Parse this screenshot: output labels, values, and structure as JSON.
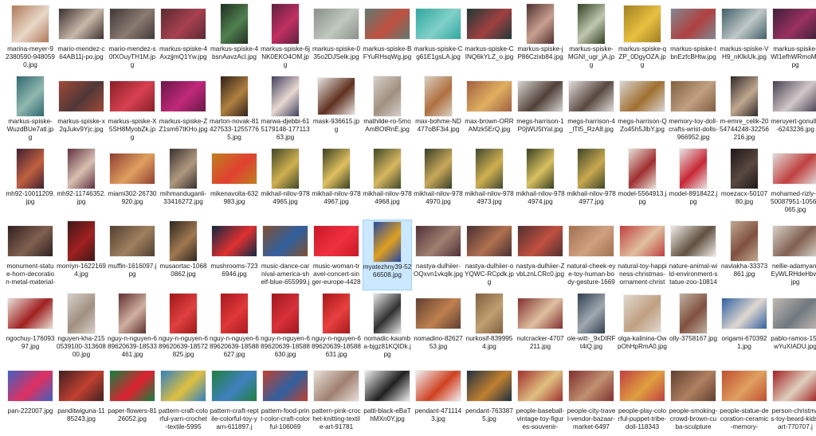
{
  "selected_index": 55,
  "files": [
    {
      "name": "marina-meyer-92380590-9480590.jpg",
      "shape": "square",
      "colors": [
        "#b07a5a",
        "#e9d8c8"
      ]
    },
    {
      "name": "mario-mendez-c64AB11j-po.jpg",
      "shape": "landscape",
      "colors": [
        "#3a3030",
        "#c8b8a8"
      ]
    },
    {
      "name": "mario-mendez-s0fXOuyTH1M.jpg",
      "shape": "landscape",
      "colors": [
        "#403838",
        "#8a7a70"
      ]
    },
    {
      "name": "markus-spiske-4AxzjjmQ1Yw.jpg",
      "shape": "landscape",
      "colors": [
        "#5a2a30",
        "#a84050"
      ]
    },
    {
      "name": "markus-spiske-4bsnAavzAcl.jpg",
      "shape": "portrait",
      "colors": [
        "#203020",
        "#508050"
      ]
    },
    {
      "name": "markus-spiske-6jNK0EKO4OM.jpg",
      "shape": "portrait",
      "colors": [
        "#602040",
        "#c03060"
      ]
    },
    {
      "name": "markus-spiske-035o2DJSelk.jpg",
      "shape": "landscape",
      "colors": [
        "#8a9088",
        "#c0c8c0"
      ]
    },
    {
      "name": "markus-spiske-BFYuRHsqWg.jpg",
      "shape": "landscape",
      "colors": [
        "#607870",
        "#c05040"
      ]
    },
    {
      "name": "markus-spiske-Cg61E1gsLA.jpg",
      "shape": "landscape",
      "colors": [
        "#30a8a0",
        "#80d0c8"
      ]
    },
    {
      "name": "markus-spiske-CINQ6kYLZ_o.jpg",
      "shape": "landscape",
      "colors": [
        "#203838",
        "#a04040"
      ]
    },
    {
      "name": "markus-spiske-jP86Czixb84.jpg",
      "shape": "portrait",
      "colors": [
        "#503030",
        "#c8a090"
      ]
    },
    {
      "name": "markus-spiske-MGNI_ugr_jA.jpg",
      "shape": "portrait",
      "colors": [
        "#304020",
        "#c0c8b0"
      ]
    },
    {
      "name": "markus-spiske-qZP_0DgyOZA.jpg",
      "shape": "square",
      "colors": [
        "#a08020",
        "#e8c040"
      ]
    },
    {
      "name": "markus-spiske-tbnEzfcBHtw.jpg",
      "shape": "landscape",
      "colors": [
        "#808890",
        "#b04040"
      ]
    },
    {
      "name": "markus-spiske-VH9_nKlkiUk.jpg",
      "shape": "landscape",
      "colors": [
        "#406068",
        "#c0c8c8"
      ]
    },
    {
      "name": "markus-spiske-Wl1efhWRmoM.jpg",
      "shape": "landscape",
      "colors": [
        "#402038",
        "#9a3060"
      ]
    },
    {
      "name": "markus-spiske-WuzdBUe7atl.jpg",
      "shape": "portrait",
      "colors": [
        "#306870",
        "#90b8b0"
      ]
    },
    {
      "name": "markus-spiske-x2qJukv9Yjc.jpg",
      "shape": "landscape",
      "colors": [
        "#a04838",
        "#503838"
      ]
    },
    {
      "name": "markus-spiske-X5SH8MyobZk.jpg",
      "shape": "landscape",
      "colors": [
        "#882028",
        "#d84050"
      ]
    },
    {
      "name": "markus-spiske-ZZ1sm67tKHo.jpg",
      "shape": "landscape",
      "colors": [
        "#6a1848",
        "#c02878"
      ]
    },
    {
      "name": "marton-novak-81427533-12557765.jpg",
      "shape": "portrait",
      "colors": [
        "#302018",
        "#b08040"
      ]
    },
    {
      "name": "marwa-djebbi-615179148-17711363.jpg",
      "shape": "portrait",
      "colors": [
        "#404060",
        "#e8d8d0"
      ]
    },
    {
      "name": "mask-936615.jpg",
      "shape": "square",
      "colors": [
        "#e8e4e0",
        "#603020"
      ]
    },
    {
      "name": "mathilde-ro-5moAmBOtRnE.jpg",
      "shape": "portrait",
      "colors": [
        "#d8d0c8",
        "#a09080"
      ]
    },
    {
      "name": "max-bohme-ND477oBF3i4.jpg",
      "shape": "portrait",
      "colors": [
        "#d8d0c0",
        "#b07040"
      ]
    },
    {
      "name": "max-brown-ORRAMzk5ErQ.jpg",
      "shape": "landscape",
      "colors": [
        "#a06040",
        "#e0b060"
      ]
    },
    {
      "name": "megs-harrison-1P0jWU5tYal.jpg",
      "shape": "landscape",
      "colors": [
        "#d8d4d0",
        "#504038"
      ]
    },
    {
      "name": "megs-harrison-4_lTt5_RzA8.jpg",
      "shape": "landscape",
      "colors": [
        "#e0dcd8",
        "#584840"
      ]
    },
    {
      "name": "megs-harrison-QZo45h5JlbY.jpg",
      "shape": "landscape",
      "colors": [
        "#d8d4d0",
        "#a07030"
      ]
    },
    {
      "name": "memory-toy-doll-crafts-wrist-dolls-966952.jpg",
      "shape": "landscape",
      "colors": [
        "#806040",
        "#c0a080"
      ]
    },
    {
      "name": "m-emre_celik-2054744248-32256216.jpg",
      "shape": "portrait",
      "colors": [
        "#302828",
        "#c0a890"
      ]
    },
    {
      "name": "meruyert-gonullu-6243236.jpg",
      "shape": "landscape",
      "colors": [
        "#484050",
        "#d0c8c8"
      ]
    },
    {
      "name": "mh92-10011209.jpg",
      "shape": "portrait",
      "colors": [
        "#402030",
        "#c06040"
      ]
    },
    {
      "name": "mh92-11746352.jpg",
      "shape": "portrait",
      "colors": [
        "#603040",
        "#d8c0b0"
      ]
    },
    {
      "name": "miami302-26730920.jpg",
      "shape": "landscape",
      "colors": [
        "#904030",
        "#e0a060"
      ]
    },
    {
      "name": "mihmanduganli-33416272.jpg",
      "shape": "portrait",
      "colors": [
        "#383030",
        "#b09880"
      ]
    },
    {
      "name": "mikenavolta-632983.jpg",
      "shape": "landscape",
      "colors": [
        "#c08020",
        "#e04030"
      ]
    },
    {
      "name": "mikhail-nilov-9784965.jpg",
      "shape": "portrait",
      "colors": [
        "#404828",
        "#d0b050"
      ]
    },
    {
      "name": "mikhail-nilov-9784967.jpg",
      "shape": "portrait",
      "colors": [
        "#384020",
        "#e0c060"
      ]
    },
    {
      "name": "mikhail-nilov-9784968.jpg",
      "shape": "portrait",
      "colors": [
        "#404828",
        "#d8b860"
      ]
    },
    {
      "name": "mikhail-nilov-9784970.jpg",
      "shape": "portrait",
      "colors": [
        "#384028",
        "#c8a858"
      ]
    },
    {
      "name": "mikhail-nilov-9784973.jpg",
      "shape": "portrait",
      "colors": [
        "#404830",
        "#d0b050"
      ]
    },
    {
      "name": "mikhail-nilov-9784974.jpg",
      "shape": "portrait",
      "colors": [
        "#384020",
        "#d8c060"
      ]
    },
    {
      "name": "mikhail-nilov-9784977.jpg",
      "shape": "portrait",
      "colors": [
        "#404828",
        "#c8a850"
      ]
    },
    {
      "name": "model-5564913.jpg",
      "shape": "portrait",
      "colors": [
        "#e8e0d8",
        "#a03030"
      ]
    },
    {
      "name": "model-8918422.jpg",
      "shape": "portrait",
      "colors": [
        "#e8e4e0",
        "#c82838"
      ]
    },
    {
      "name": "moezacx-5010780.jpg",
      "shape": "portrait",
      "colors": [
        "#201818",
        "#584840"
      ]
    },
    {
      "name": "mohamed-rizly-150087951-10566065.jpg",
      "shape": "landscape",
      "colors": [
        "#e0dcd8",
        "#c04040"
      ]
    },
    {
      "name": "monument-statue-horn-decoration-metal-material-760296.jpg",
      "shape": "landscape",
      "colors": [
        "#302020",
        "#806050"
      ]
    },
    {
      "name": "morriyn-16221694.jpg",
      "shape": "portrait",
      "colors": [
        "#401818",
        "#a02020"
      ]
    },
    {
      "name": "muffin-1616097.jpg",
      "shape": "landscape",
      "colors": [
        "#504030",
        "#a08060"
      ]
    },
    {
      "name": "musaortac-10680862.jpg",
      "shape": "portrait",
      "colors": [
        "#302820",
        "#a07850"
      ]
    },
    {
      "name": "mushrooms-7236946.jpg",
      "shape": "landscape",
      "colors": [
        "#102840",
        "#e03030"
      ]
    },
    {
      "name": "music-dance-carnival-america-shelf-blue-655999.jpg",
      "shape": "landscape",
      "colors": [
        "#805030",
        "#3060a0"
      ]
    },
    {
      "name": "music-woman-travel-concert-singer-europe-442810.jpg",
      "shape": "landscape",
      "colors": [
        "#c81828",
        "#f03040"
      ]
    },
    {
      "name": "myatezhny39-5266508.jpg",
      "shape": "portrait",
      "colors": [
        "#2848a0",
        "#e0a020"
      ]
    },
    {
      "name": "nastya-dulhiier-OQxvn1vkqlk.jpg",
      "shape": "landscape",
      "colors": [
        "#503038",
        "#a08070"
      ]
    },
    {
      "name": "nastya-dulhiier-oYQWC-RCpdk.jpg",
      "shape": "landscape",
      "colors": [
        "#483030",
        "#b07050"
      ]
    },
    {
      "name": "nastya-dulhiier-ZvbLznLCRc0.jpg",
      "shape": "landscape",
      "colors": [
        "#503030",
        "#c05040"
      ]
    },
    {
      "name": "natural-cheek-eye-toy-human-body-gesture-1669228.jpg",
      "shape": "landscape",
      "colors": [
        "#a07050",
        "#d0a080"
      ]
    },
    {
      "name": "natural-toy-happiness-christmas-ornament-christmas-decor....jpg",
      "shape": "landscape",
      "colors": [
        "#c04040",
        "#e0c0a0"
      ]
    },
    {
      "name": "nature-animal-wild-environment-statue-zoo-1081441.jpg",
      "shape": "landscape",
      "colors": [
        "#f0ece8",
        "#605040"
      ]
    },
    {
      "name": "navlakha-33373861.jpg",
      "shape": "portrait",
      "colors": [
        "#c0a890",
        "#805040"
      ]
    },
    {
      "name": "nellie-adamyan-EyWLRHdeHbw.jpg",
      "shape": "landscape",
      "colors": [
        "#d8d0c8",
        "#806050"
      ]
    },
    {
      "name": "ngochuy-17609397.jpg",
      "shape": "landscape",
      "colors": [
        "#e8e0d8",
        "#a02020"
      ]
    },
    {
      "name": "nguyen-kha-2150539100-31360800.jpg",
      "shape": "portrait",
      "colors": [
        "#d8d0c8",
        "#a09080"
      ]
    },
    {
      "name": "nguy-n-nguyen-689620639-18533461.jpg",
      "shape": "portrait",
      "colors": [
        "#603030",
        "#d0b0a0"
      ]
    },
    {
      "name": "nguy-n-nguyen-689620639-18572825.jpg",
      "shape": "portrait",
      "colors": [
        "#a01818",
        "#e04040"
      ]
    },
    {
      "name": "nguy-n-nguyen-689620639-18588627.jpg",
      "shape": "portrait",
      "colors": [
        "#a81820",
        "#e03838"
      ]
    },
    {
      "name": "nguy-n-nguyen-689620639-18588630.jpg",
      "shape": "portrait",
      "colors": [
        "#a01820",
        "#d83038"
      ]
    },
    {
      "name": "nguy-n-nguyen-689620639-18588631.jpg",
      "shape": "portrait",
      "colors": [
        "#a81818",
        "#e84040"
      ]
    },
    {
      "name": "nomadic-kaumba-bjgz81KQIDk.jpg",
      "shape": "portrait",
      "colors": [
        "#e8e8e8",
        "#303030"
      ]
    },
    {
      "name": "nomadino-8262753.jpg",
      "shape": "landscape",
      "colors": [
        "#604030",
        "#c08050"
      ]
    },
    {
      "name": "nurkosif-8399954.jpg",
      "shape": "portrait",
      "colors": [
        "#806040",
        "#c0a070"
      ]
    },
    {
      "name": "nutcracker-4707211.jpg",
      "shape": "landscape",
      "colors": [
        "#803030",
        "#e0c0a0"
      ]
    },
    {
      "name": "ole-witt-_9xDIRFt4iQ.jpg",
      "shape": "portrait",
      "colors": [
        "#304050",
        "#a0a8b0"
      ]
    },
    {
      "name": "olga-kalinina-OwpOhHpRmA0.jpg",
      "shape": "square",
      "colors": [
        "#e0d8d0",
        "#c0a080"
      ]
    },
    {
      "name": "olly-3758167.jpg",
      "shape": "portrait",
      "colors": [
        "#c0b0a0",
        "#805040"
      ]
    },
    {
      "name": "origami-6703921.jpg",
      "shape": "landscape",
      "colors": [
        "#3060a0",
        "#e0d8d0"
      ]
    },
    {
      "name": "pablo-ramos-15xwYuXIADU.jpg",
      "shape": "landscape",
      "colors": [
        "#c0b8b0",
        "#707880"
      ]
    },
    {
      "name": "pan-222007.jpg",
      "shape": "landscape",
      "colors": [
        "#4060c0",
        "#e03060"
      ]
    },
    {
      "name": "panditwiguna-1185243.jpg",
      "shape": "landscape",
      "colors": [
        "#402020",
        "#c04030"
      ]
    },
    {
      "name": "paper-flowers-8126052.jpg",
      "shape": "landscape",
      "colors": [
        "#108040",
        "#e02030"
      ]
    },
    {
      "name": "pattern-craft-colorful-yarn-crochet-textile-5995",
      "shape": "landscape",
      "colors": [
        "#3080c0",
        "#e0c040"
      ]
    },
    {
      "name": "pattern-craft-reptile-colorful-toy-yarn-611897.j",
      "shape": "landscape",
      "colors": [
        "#208040",
        "#4080c0"
      ]
    },
    {
      "name": "pattern-food-print-color-craft-colorful-106069",
      "shape": "landscape",
      "colors": [
        "#c04030",
        "#3060a0"
      ]
    },
    {
      "name": "pattern-pink-crochet-knitting-textile-art-91781",
      "shape": "landscape",
      "colors": [
        "#e8e0d8",
        "#a08070"
      ]
    },
    {
      "name": "patti-black-eBaThMXn0Y.jpg",
      "shape": "landscape",
      "colors": [
        "#f0f0f0",
        "#202020"
      ]
    },
    {
      "name": "pendant-4711143.jpg",
      "shape": "landscape",
      "colors": [
        "#f0f0f0",
        "#d04020"
      ]
    },
    {
      "name": "pendant-7633875.jpg",
      "shape": "landscape",
      "colors": [
        "#203040",
        "#c08030"
      ]
    },
    {
      "name": "people-baseball-vintage-toy-figures-souvenir-",
      "shape": "landscape",
      "colors": [
        "#a03030",
        "#e0c080"
      ]
    },
    {
      "name": "people-city-travel-vendor-bazaar-market-6497",
      "shape": "landscape",
      "colors": [
        "#803030",
        "#c09070"
      ]
    },
    {
      "name": "people-play-colorful-puppet-tribe-doll-118343",
      "shape": "landscape",
      "colors": [
        "#c04040",
        "#e0a040"
      ]
    },
    {
      "name": "people-smoking-crowd-brown-cuba-sculpture",
      "shape": "landscape",
      "colors": [
        "#604030",
        "#b08060"
      ]
    },
    {
      "name": "people-statue-decoration-ceramic-memory-",
      "shape": "landscape",
      "colors": [
        "#c05030",
        "#e0a060"
      ]
    },
    {
      "name": "person-christmas-toy-beard-kids-art-770707.j",
      "shape": "landscape",
      "colors": [
        "#a02020",
        "#e0d0c0"
      ]
    }
  ]
}
